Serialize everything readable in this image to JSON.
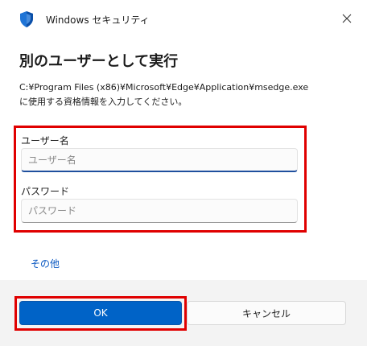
{
  "titlebar": {
    "app_name": "Windows セキュリティ",
    "icon": "shield-icon",
    "close_icon": "close-icon"
  },
  "dialog": {
    "heading": "別のユーザーとして実行",
    "description_line1": "C:¥Program Files (x86)¥Microsoft¥Edge¥Application¥msedge.exe",
    "description_line2": "に使用する資格情報を入力してください。"
  },
  "credentials": {
    "username_label": "ユーザー名",
    "username_placeholder": "ユーザー名",
    "username_value": "",
    "password_label": "パスワード",
    "password_placeholder": "パスワード",
    "password_value": ""
  },
  "more_choices": {
    "label": "その他"
  },
  "buttons": {
    "ok_label": "OK",
    "cancel_label": "キャンセル"
  },
  "colors": {
    "accent": "#0063c7",
    "highlight_frame": "#e00000",
    "link": "#0a58c2"
  }
}
